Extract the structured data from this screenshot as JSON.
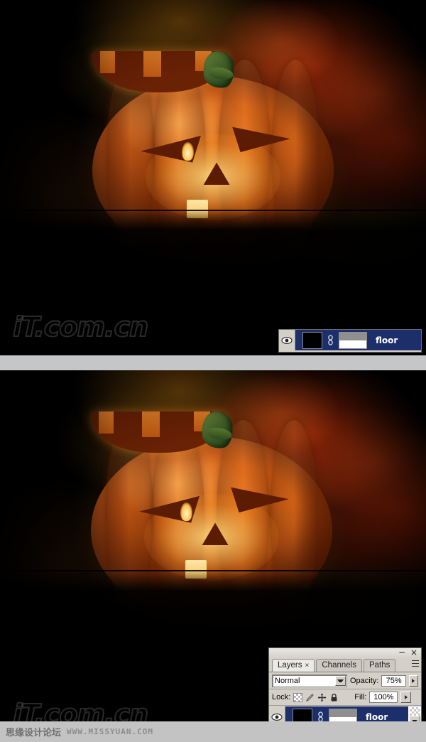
{
  "scenes": [
    {
      "name": "top-artwork",
      "artwork_subject": "jack-o-lantern",
      "watermark": "iT.com.cn"
    },
    {
      "name": "bottom-artwork",
      "artwork_subject": "jack-o-lantern",
      "watermark": "iT.com.cn"
    }
  ],
  "layers_panel_top": {
    "layer_row": {
      "visibility_icon": "eye-icon",
      "link_icon": "link-icon",
      "layer_name": "floor"
    }
  },
  "layers_panel_bottom": {
    "window_controls": {
      "minimize": "−",
      "close": "×"
    },
    "panel_menu_icon": "panel-menu-icon",
    "tabs": [
      {
        "label": "Layers",
        "close": "×",
        "active": true
      },
      {
        "label": "Channels",
        "active": false
      },
      {
        "label": "Paths",
        "active": false
      }
    ],
    "blend_mode": {
      "value": "Normal"
    },
    "opacity": {
      "label": "Opacity:",
      "value": "75%"
    },
    "lock": {
      "label": "Lock:",
      "icons": [
        "transparency-checker-icon",
        "paintbrush-icon",
        "move-icon",
        "padlock-icon"
      ]
    },
    "fill": {
      "label": "Fill:",
      "value": "100%"
    },
    "layer_row": {
      "visibility_icon": "eye-icon",
      "link_icon": "link-icon",
      "layer_name": "floor"
    }
  },
  "footer": {
    "site_name_cn": "思缘设计论坛",
    "site_url": "WWW.MISSYUAN.COM"
  },
  "colors": {
    "panel_face": "#d4d0c8",
    "layer_selected": "#1c2f6b",
    "footer_bar": "#c3c3c3",
    "separator_bar": "#c5c6c8"
  }
}
